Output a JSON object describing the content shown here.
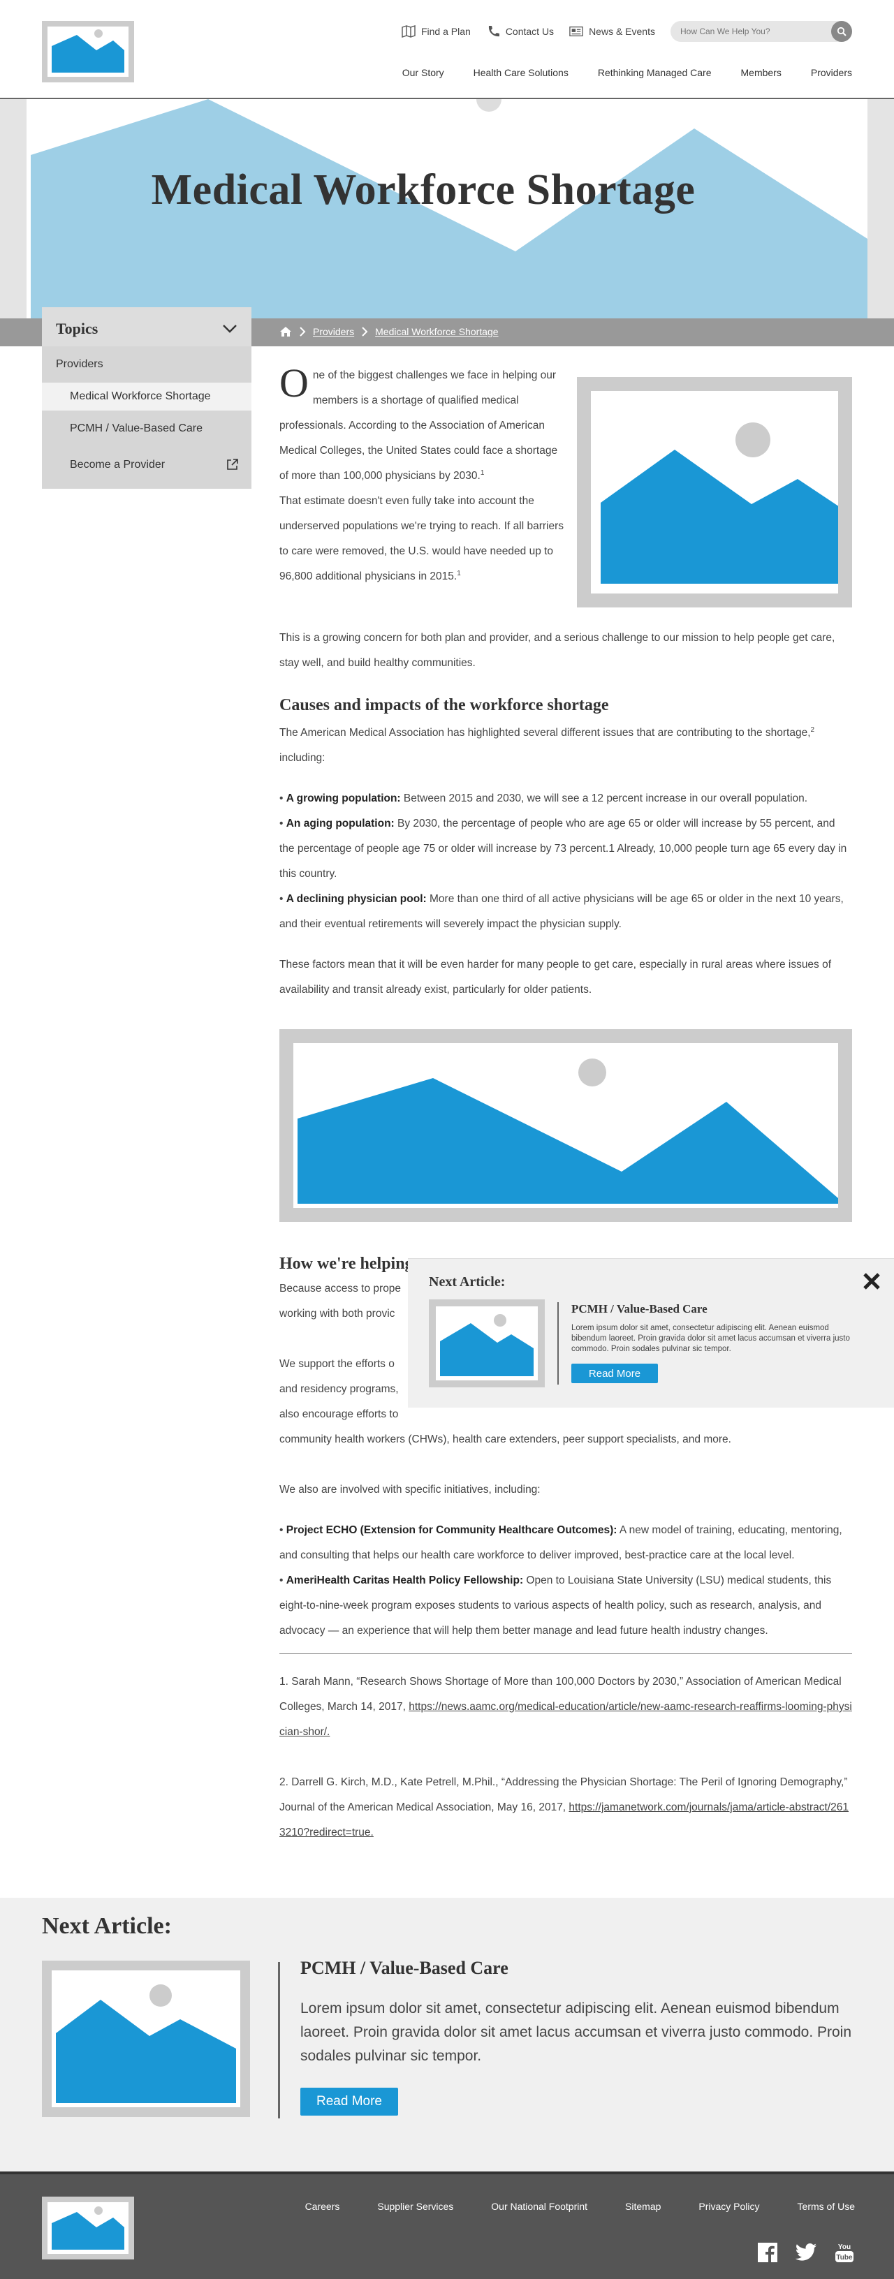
{
  "header": {
    "utility": [
      {
        "label": "Find a Plan",
        "icon": "map-icon"
      },
      {
        "label": "Contact Us",
        "icon": "phone-icon"
      },
      {
        "label": "News & Events",
        "icon": "newspaper-icon"
      }
    ],
    "search_placeholder": "How Can We Help You?",
    "nav": [
      "Our Story",
      "Health Care Solutions",
      "Rethinking Managed Care",
      "Members",
      "Providers"
    ]
  },
  "hero": {
    "title": "Medical Workforce Shortage"
  },
  "breadcrumb": {
    "items": [
      "Providers",
      "Medical Workforce Shortage"
    ]
  },
  "sidebar": {
    "title": "Topics",
    "section": "Providers",
    "items": [
      "Medical Workforce Shortage",
      "PCMH / Value-Based Care",
      "Become a Provider"
    ]
  },
  "article": {
    "dropcap": "O",
    "intro_1": "ne of the biggest challenges we face in helping our members is a shortage of qualified medical professionals. According to the Association of American Medical Colleges, the United States could face a shortage of more than 100,000 physicians by 2030.",
    "intro_1_sup": "1",
    "intro_2": "That estimate doesn't even fully take into account the underserved populations we're trying to reach. If all barriers to care were removed, the U.S. would have needed up to 96,800 additional physicians in 2015.",
    "intro_2_sup": "1",
    "growing_concern": "This is a growing concern for both plan and provider, and a serious challenge to our mission to help people get care, stay well, and build healthy communities.",
    "causes_heading": "Causes and impacts of the workforce shortage",
    "causes_intro": "The American Medical Association has highlighted several different issues that are contributing to the shortage,",
    "causes_intro_sup": "2",
    "causes_intro_tail": " including:",
    "bullets": [
      {
        "bold": "A growing population:",
        "text": " Between 2015 and 2030, we will see a 12 percent increase in our overall population."
      },
      {
        "bold": "An aging population:",
        "text": " By 2030, the percentage of people who are age 65 or older will increase by 55 percent, and the percentage of people age 75 or older will increase by 73 percent.1 Already, 10,000 people turn age 65 every day in this country."
      },
      {
        "bold": "A declining physician pool:",
        "text": " More than one third of all active physicians will be age 65 or older in the next 10 years, and their eventual retirements will severely impact the physician supply."
      }
    ],
    "factors": "These factors mean that it will be even harder for many people to get care, especially in rural areas where issues of availability and transit already exist, particularly for older patients.",
    "helping_heading": "How we're helping",
    "helping_p1_a": "Because access to prope",
    "helping_p1_b": "working with both provic",
    "helping_p2_a": "We support the efforts o",
    "helping_p2_b": "and residency programs,",
    "helping_p2_c": "also encourage efforts to",
    "helping_p2_d": "community health workers (CHWs), health care extenders, peer support specialists, and more.",
    "initiatives_intro": "We also are involved with specific initiatives, including:",
    "initiatives": [
      {
        "bold": "Project ECHO (Extension for Community Healthcare Outcomes):",
        "text": " A new model of training, educating, mentoring, and consulting that helps our health care workforce to deliver improved, best-practice care at the local level."
      },
      {
        "bold": "AmeriHealth Caritas Health Policy Fellowship:",
        "text": " Open to Louisiana State University (LSU) medical students, this eight-to-nine-week program exposes students to various aspects of health policy, such as research, analysis, and advocacy — an experience that will help them better manage and lead future health industry changes."
      }
    ],
    "ref1_text": "1. Sarah Mann, “Research Shows Shortage of More than 100,000 Doctors by 2030,” Association of American Medical Colleges, March 14, 2017, ",
    "ref1_link": "https://news.aamc.org/medical-education/article/new-aamc-research-reaffirms-looming-physician-shor/.",
    "ref2_text": "2. Darrell G. Kirch, M.D., Kate Petrell, M.Phil., “Addressing the Physician Shortage: The Peril of Ignoring Demography,” Journal of the American Medical Association, May 16, 2017, ",
    "ref2_link": "https://jamanetwork.com/journals/jama/article-abstract/2613210?redirect=true."
  },
  "popup": {
    "title": "Next Article:",
    "heading": "PCMH / Value-Based Care",
    "body": "Lorem ipsum dolor sit amet, consectetur adipiscing elit. Aenean euismod bibendum laoreet. Proin gravida dolor sit amet lacus accumsan et viverra justo commodo. Proin sodales pulvinar sic tempor.",
    "button": "Read More"
  },
  "next_article": {
    "title": "Next Article:",
    "heading": "PCMH / Value-Based Care",
    "body": "Lorem ipsum dolor sit amet, consectetur adipiscing elit. Aenean euismod bibendum laoreet. Proin gravida dolor sit amet lacus accumsan et viverra justo commodo. Proin sodales pulvinar sic tempor.",
    "button": "Read More"
  },
  "footer": {
    "links": [
      "Careers",
      "Supplier Services",
      "Our National Footprint",
      "Sitemap",
      "Privacy Policy",
      "Terms of Use"
    ],
    "social": [
      "facebook-icon",
      "twitter-icon",
      "youtube-icon"
    ]
  },
  "colors": {
    "accent": "#1a97d5",
    "hero_mountain": "#9ecfe6",
    "placeholder_frame": "#cccccc"
  }
}
